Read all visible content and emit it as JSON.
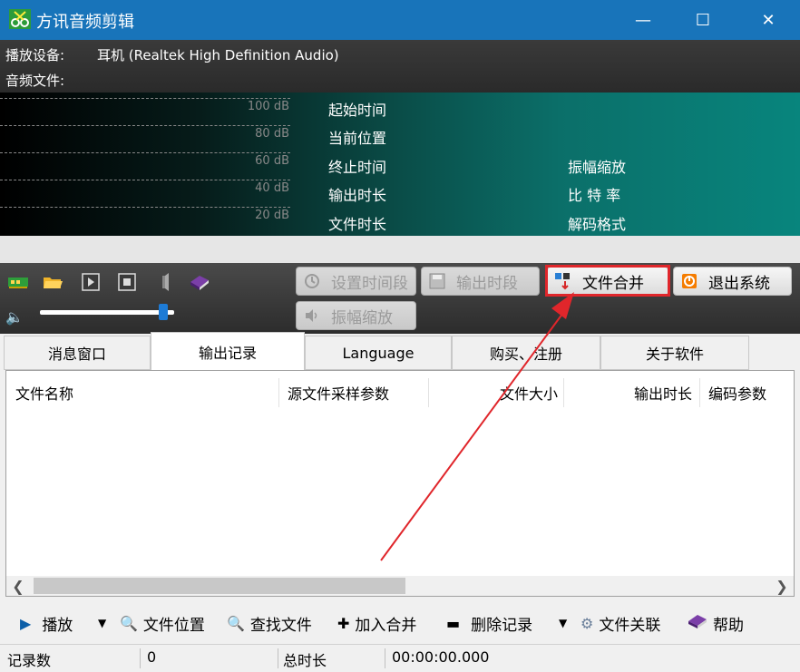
{
  "window": {
    "title": "方讯音频剪辑",
    "minimize": "—",
    "maximize": "☐",
    "close": "✕"
  },
  "info": {
    "device_label": "播放设备:",
    "device_value": "耳机 (Realtek High Definition Audio)",
    "file_label": "音频文件:"
  },
  "meter": {
    "db_labels": [
      "100 dB",
      "80 dB",
      "60 dB",
      "40 dB",
      "20 dB"
    ],
    "left_labels": [
      "起始时间",
      "当前位置",
      "终止时间",
      "输出时长",
      "文件时长"
    ],
    "right_labels": [
      "振幅缩放",
      "比 特 率",
      "解码格式"
    ]
  },
  "toolbar": {
    "set_segment": "设置时间段",
    "output_segment": "输出时段",
    "merge_files": "文件合并",
    "exit_system": "退出系统",
    "amplitude": "振幅缩放",
    "volume_level": 0.95
  },
  "tabs": [
    {
      "label": "消息窗口"
    },
    {
      "label": "输出记录"
    },
    {
      "label": "Language"
    },
    {
      "label": "购买、注册"
    },
    {
      "label": "关于软件"
    }
  ],
  "list": {
    "columns": [
      "文件名称",
      "源文件采样参数",
      "文件大小",
      "输出时长",
      "编码参数"
    ]
  },
  "bottom": {
    "play": "播放",
    "file_location": "文件位置",
    "find_file": "查找文件",
    "add_merge": "加入合并",
    "delete_record": "删除记录",
    "file_assoc": "文件关联",
    "help": "帮助"
  },
  "status": {
    "records_label": "记录数",
    "records_value": "0",
    "total_label": "总时长",
    "total_value": "00:00:00.000"
  },
  "colors": {
    "titlebar": "#1874ba",
    "highlight": "#e0262b"
  }
}
